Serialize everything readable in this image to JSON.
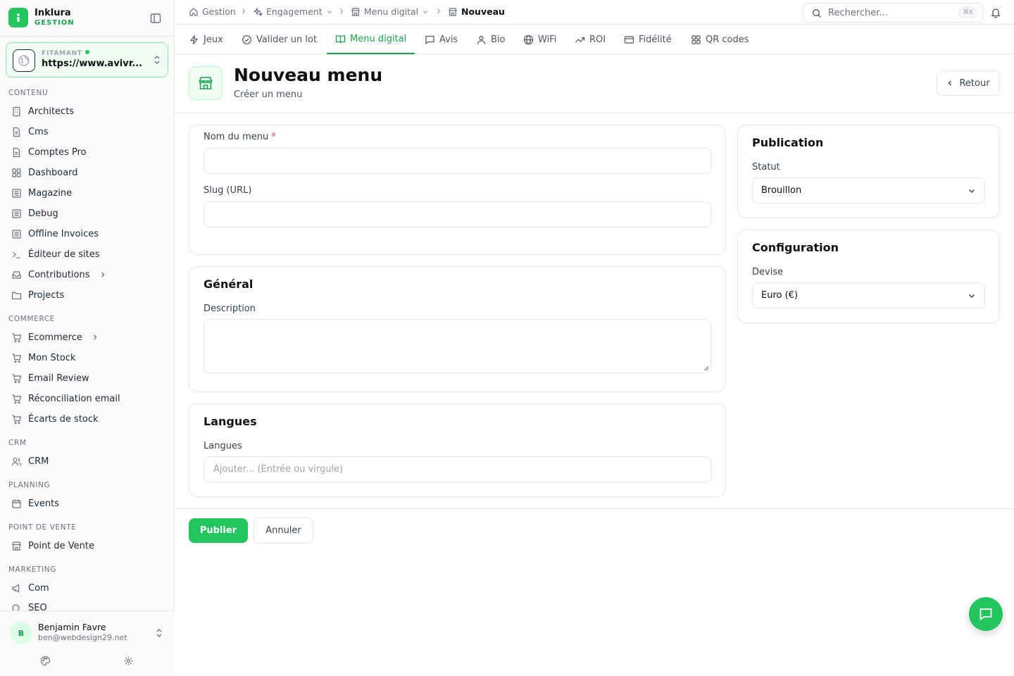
{
  "brand": {
    "name": "Inklura",
    "subtitle": "GESTION"
  },
  "site": {
    "label": "FITAMANT",
    "url": "https://www.avivr..."
  },
  "sections": {
    "contenu": "CONTENU",
    "commerce": "COMMERCE",
    "crm": "CRM",
    "planning": "PLANNING",
    "pdv": "POINT DE VENTE",
    "marketing": "MARKETING"
  },
  "nav": {
    "architects": "Architects",
    "cms": "Cms",
    "comptes_pro": "Comptes Pro",
    "dashboard": "Dashboard",
    "magazine": "Magazine",
    "debug": "Debug",
    "offline_invoices": "Offline Invoices",
    "editeur": "Éditeur de sites",
    "contributions": "Contributions",
    "projects": "Projects",
    "ecommerce": "Ecommerce",
    "mon_stock": "Mon Stock",
    "email_review": "Email Review",
    "reconciliation": "Réconciliation email",
    "ecarts": "Écarts de stock",
    "crm": "CRM",
    "events": "Events",
    "point_de_vente": "Point de Vente",
    "com": "Com",
    "seo": "SEO"
  },
  "user": {
    "initial": "B",
    "name": "Benjamin Favre",
    "email": "ben@webdesign29.net"
  },
  "breadcrumb": {
    "gestion": "Gestion",
    "engagement": "Engagement",
    "menu_digital": "Menu digital",
    "nouveau": "Nouveau"
  },
  "search": {
    "placeholder": "Rechercher...",
    "shortcut": "⌘K"
  },
  "tabs": {
    "jeux": "Jeux",
    "valider": "Valider un lot",
    "menu_digital": "Menu digital",
    "avis": "Avis",
    "bio": "Bio",
    "wifi": "WiFi",
    "roi": "ROI",
    "fidelite": "Fidélité",
    "qr": "QR codes"
  },
  "header": {
    "title": "Nouveau menu",
    "subtitle": "Créer un menu",
    "back": "Retour"
  },
  "form": {
    "nom_label": "Nom du menu",
    "required": "*",
    "slug_label": "Slug (URL)",
    "general_title": "Général",
    "description_label": "Description",
    "langues_title": "Langues",
    "langues_label": "Langues",
    "langues_placeholder": "Ajouter... (Entrée ou virgule)"
  },
  "publication": {
    "title": "Publication",
    "statut_label": "Statut",
    "statut_value": "Brouillon"
  },
  "configuration": {
    "title": "Configuration",
    "devise_label": "Devise",
    "devise_value": "Euro (€)"
  },
  "actions": {
    "publish": "Publier",
    "cancel": "Annuler"
  },
  "colors": {
    "accent": "#22c55e",
    "accent_dark": "#16a34a",
    "border": "#e5e7eb",
    "required": "#ef4444"
  }
}
